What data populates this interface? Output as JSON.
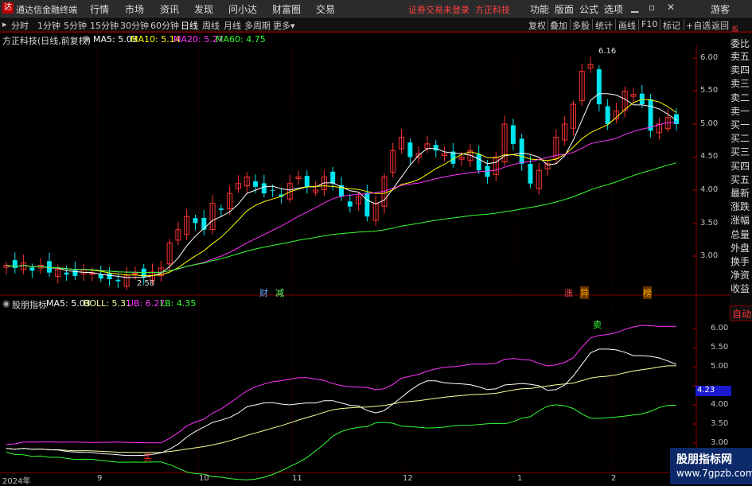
{
  "app": {
    "title": "通达信金融终端",
    "menu": [
      "行情",
      "市场",
      "资讯",
      "发现",
      "问小达",
      "财富圈",
      "交易"
    ],
    "notice": "证券交易未登录",
    "stock_name_header": "方正科技",
    "top_right_menu": [
      "功能",
      "版面",
      "公式",
      "选项"
    ],
    "guest": "游客"
  },
  "periods": [
    "分时",
    "1分钟",
    "5分钟",
    "15分钟",
    "30分钟",
    "60分钟",
    "日线",
    "周线",
    "月线",
    "多周期",
    "更多"
  ],
  "active_period": "日线",
  "tools": [
    "复权",
    "叠加",
    "多股",
    "统计",
    "画线",
    "F10",
    "标记",
    "+自选",
    "返回"
  ],
  "main_info": {
    "title": "方正科技(日线,前复权)",
    "ma": [
      {
        "label": "MA5: 5.03",
        "color": "#ffffff"
      },
      {
        "label": "MA10: 5.14",
        "color": "#ffff00"
      },
      {
        "label": "MA20: 5.27",
        "color": "#ff33ff"
      },
      {
        "label": "MA60: 4.75",
        "color": "#33ff33"
      }
    ]
  },
  "main_axis": [
    "6.00",
    "5.50",
    "5.00",
    "4.50",
    "4.00",
    "3.50",
    "3.00"
  ],
  "high_label": "6.16",
  "low_label": "2.58",
  "markers": [
    {
      "text": "财",
      "color": "#66aaff"
    },
    {
      "text": "减",
      "color": "#66ff66"
    },
    {
      "text": "涨",
      "color": "#ff5050"
    },
    {
      "text": "异",
      "color": "#ffaa00"
    },
    {
      "text": "榜",
      "color": "#ffaa00"
    }
  ],
  "right_panel": {
    "top": "委比",
    "items": [
      "卖五",
      "卖四",
      "卖三",
      "卖二",
      "卖一",
      "买一",
      "买二",
      "买三",
      "买四",
      "买五",
      "最新",
      "涨跌",
      "涨幅",
      "总量",
      "外盘",
      "换手",
      "净资",
      "收益"
    ],
    "auto": "自动",
    "small": "股"
  },
  "sub_info": {
    "title": "股朋指标",
    "items": [
      {
        "label": "MA5: 5.03",
        "color": "#ffffff"
      },
      {
        "label": "BOLL: 5.31",
        "color": "#ffff99"
      },
      {
        "label": "UB: 6.27",
        "color": "#ff33ff"
      },
      {
        "label": "LB: 4.35",
        "color": "#33ff33"
      }
    ]
  },
  "sub_axis": [
    "6.00",
    "5.50",
    "5.00",
    "4.50",
    "4.00",
    "3.50",
    "3.00"
  ],
  "sub_current": "4.23",
  "sub_labels": {
    "sell": "卖",
    "buy": "买"
  },
  "x_labels": [
    "2024年",
    "9",
    "10",
    "11",
    "12",
    "1",
    "2"
  ],
  "watermark": {
    "line1": "股朋指标网",
    "line2": "www.7gpzb.com"
  },
  "chart_data": {
    "type": "candlestick",
    "title": "方正科技(日线,前复权)",
    "price_range": [
      2.58,
      6.16
    ],
    "y_ticks": [
      3.0,
      3.5,
      4.0,
      4.5,
      5.0,
      5.5,
      6.0
    ],
    "x_labels": [
      "2024年",
      "9",
      "10",
      "11",
      "12",
      "1",
      "2"
    ],
    "series_closes_approx": [
      2.86,
      2.82,
      2.9,
      2.78,
      2.86,
      2.75,
      2.8,
      2.72,
      2.7,
      2.8,
      2.74,
      2.66,
      2.65,
      2.62,
      2.71,
      2.74,
      2.68,
      2.76,
      2.82,
      3.2,
      3.4,
      3.6,
      3.5,
      3.4,
      3.8,
      3.7,
      3.95,
      4.1,
      4.2,
      4.05,
      3.95,
      4.0,
      3.9,
      4.1,
      4.2,
      4.05,
      4.0,
      4.2,
      4.1,
      3.9,
      3.75,
      3.9,
      3.6,
      3.8,
      4.2,
      4.6,
      4.8,
      4.5,
      4.55,
      4.7,
      4.6,
      4.55,
      4.4,
      4.5,
      4.6,
      4.3,
      4.2,
      4.5,
      5.0,
      4.7,
      4.4,
      4.1,
      4.3,
      4.4,
      4.8,
      5.0,
      5.3,
      5.8,
      5.9,
      5.3,
      5.0,
      5.2,
      5.5,
      5.45,
      5.3,
      4.9,
      5.0,
      5.1,
      5.0
    ],
    "indicators": {
      "MA5": 5.03,
      "MA10": 5.14,
      "MA20": 5.27,
      "MA60": 4.75
    },
    "sub_indicator": {
      "name": "股朋指标",
      "MA5": 5.03,
      "BOLL": 5.31,
      "UB": 6.27,
      "LB": 4.35
    }
  }
}
